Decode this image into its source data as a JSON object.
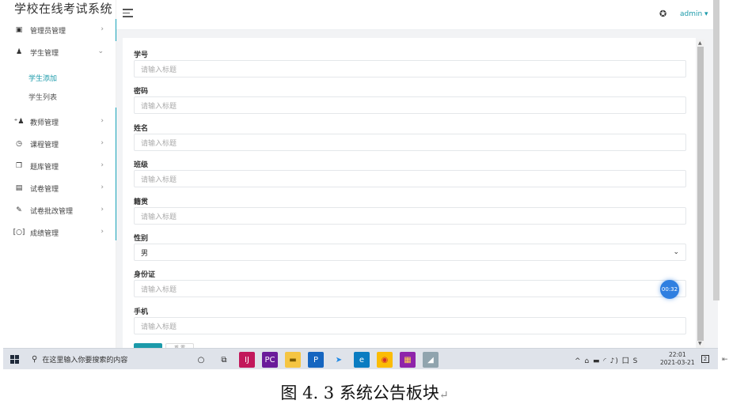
{
  "app_title": "学校在线考试系统",
  "sidebar": {
    "items": [
      {
        "icon": "id-card-icon",
        "glyph": "▣",
        "label": "管理员管理",
        "arrow": "›"
      },
      {
        "icon": "user-icon",
        "glyph": "♟",
        "label": "学生管理",
        "arrow": "⌄",
        "open": true,
        "children": [
          {
            "label": "学生添加",
            "active": true
          },
          {
            "label": "学生列表",
            "active": false
          }
        ]
      },
      {
        "icon": "user-plus-icon",
        "glyph": "⁺♟",
        "label": "教师管理",
        "arrow": "›"
      },
      {
        "icon": "clock-icon",
        "glyph": "◷",
        "label": "课程管理",
        "arrow": "›"
      },
      {
        "icon": "copy-icon",
        "glyph": "❐",
        "label": "题库管理",
        "arrow": "›"
      },
      {
        "icon": "newspaper-icon",
        "glyph": "▤",
        "label": "试卷管理",
        "arrow": "›"
      },
      {
        "icon": "pencil-icon",
        "glyph": "✎",
        "label": "试卷批改管理",
        "arrow": "›"
      },
      {
        "icon": "bracket-icon",
        "glyph": "[○]",
        "label": "成绩管理",
        "arrow": "›"
      }
    ]
  },
  "topbar": {
    "user": "admin ▾",
    "palette_icon": "palette-icon",
    "menu_icon": "hamburger-icon"
  },
  "form": {
    "fields": [
      {
        "label": "学号",
        "placeholder": "请输入标题"
      },
      {
        "label": "密码",
        "placeholder": "请输入标题"
      },
      {
        "label": "姓名",
        "placeholder": "请输入标题"
      },
      {
        "label": "班级",
        "placeholder": "请输入标题"
      },
      {
        "label": "籍贯",
        "placeholder": "请输入标题"
      },
      {
        "label": "性别",
        "value": "男",
        "type": "select"
      },
      {
        "label": "身份证",
        "placeholder": "请输入标题"
      },
      {
        "label": "手机",
        "placeholder": "请输入标题"
      }
    ],
    "reset_label": "重 置"
  },
  "timer": "00:32",
  "taskbar": {
    "search_text": "在这里输入你要搜索的内容",
    "apps": [
      {
        "name": "cortana-icon",
        "glyph": "○",
        "bg": "transparent",
        "color": "#222"
      },
      {
        "name": "task-view-icon",
        "glyph": "⧉",
        "bg": "transparent",
        "color": "#222"
      },
      {
        "name": "intellij-icon",
        "glyph": "IJ",
        "bg": "#c2185b",
        "color": "#fff"
      },
      {
        "name": "pycharm-icon",
        "glyph": "PC",
        "bg": "#6a1b9a",
        "color": "#fff"
      },
      {
        "name": "file-explorer-icon",
        "glyph": "▬",
        "bg": "#f5c542",
        "color": "#7a5a00"
      },
      {
        "name": "p-app-icon",
        "glyph": "P",
        "bg": "#1565c0",
        "color": "#fff"
      },
      {
        "name": "arrow-app-icon",
        "glyph": "➤",
        "bg": "transparent",
        "color": "#1e88e5"
      },
      {
        "name": "edge-icon",
        "glyph": "e",
        "bg": "#0a7cc1",
        "color": "#fff"
      },
      {
        "name": "chrome-icon",
        "glyph": "◉",
        "bg": "#fbbc05",
        "color": "#d32f2f"
      },
      {
        "name": "winrar-icon",
        "glyph": "▦",
        "bg": "#8e24aa",
        "color": "#ffd54f"
      },
      {
        "name": "notepad-icon",
        "glyph": "◢",
        "bg": "#90a4ae",
        "color": "#fff"
      }
    ],
    "tray": "^ ⌂ ▬ ◜ ♪) 囗 S",
    "time": "22:01",
    "date": "2021-03-21",
    "notify_count": "2"
  },
  "caption": {
    "text": "图 4. 3 系统公告板块",
    "return_mark": "↵"
  },
  "colors": {
    "accent": "#1b9aaa",
    "timer": "#2f7fe0",
    "background": "#f2f3f5"
  }
}
